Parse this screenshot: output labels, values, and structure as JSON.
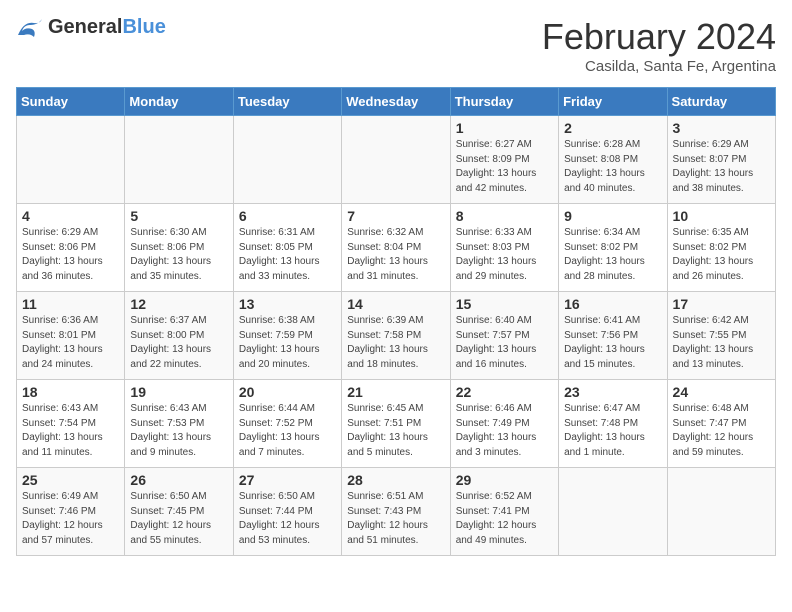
{
  "logo": {
    "general": "General",
    "blue": "Blue"
  },
  "title": "February 2024",
  "subtitle": "Casilda, Santa Fe, Argentina",
  "weekdays": [
    "Sunday",
    "Monday",
    "Tuesday",
    "Wednesday",
    "Thursday",
    "Friday",
    "Saturday"
  ],
  "weeks": [
    [
      {
        "day": "",
        "info": ""
      },
      {
        "day": "",
        "info": ""
      },
      {
        "day": "",
        "info": ""
      },
      {
        "day": "",
        "info": ""
      },
      {
        "day": "1",
        "info": "Sunrise: 6:27 AM\nSunset: 8:09 PM\nDaylight: 13 hours and 42 minutes."
      },
      {
        "day": "2",
        "info": "Sunrise: 6:28 AM\nSunset: 8:08 PM\nDaylight: 13 hours and 40 minutes."
      },
      {
        "day": "3",
        "info": "Sunrise: 6:29 AM\nSunset: 8:07 PM\nDaylight: 13 hours and 38 minutes."
      }
    ],
    [
      {
        "day": "4",
        "info": "Sunrise: 6:29 AM\nSunset: 8:06 PM\nDaylight: 13 hours and 36 minutes."
      },
      {
        "day": "5",
        "info": "Sunrise: 6:30 AM\nSunset: 8:06 PM\nDaylight: 13 hours and 35 minutes."
      },
      {
        "day": "6",
        "info": "Sunrise: 6:31 AM\nSunset: 8:05 PM\nDaylight: 13 hours and 33 minutes."
      },
      {
        "day": "7",
        "info": "Sunrise: 6:32 AM\nSunset: 8:04 PM\nDaylight: 13 hours and 31 minutes."
      },
      {
        "day": "8",
        "info": "Sunrise: 6:33 AM\nSunset: 8:03 PM\nDaylight: 13 hours and 29 minutes."
      },
      {
        "day": "9",
        "info": "Sunrise: 6:34 AM\nSunset: 8:02 PM\nDaylight: 13 hours and 28 minutes."
      },
      {
        "day": "10",
        "info": "Sunrise: 6:35 AM\nSunset: 8:02 PM\nDaylight: 13 hours and 26 minutes."
      }
    ],
    [
      {
        "day": "11",
        "info": "Sunrise: 6:36 AM\nSunset: 8:01 PM\nDaylight: 13 hours and 24 minutes."
      },
      {
        "day": "12",
        "info": "Sunrise: 6:37 AM\nSunset: 8:00 PM\nDaylight: 13 hours and 22 minutes."
      },
      {
        "day": "13",
        "info": "Sunrise: 6:38 AM\nSunset: 7:59 PM\nDaylight: 13 hours and 20 minutes."
      },
      {
        "day": "14",
        "info": "Sunrise: 6:39 AM\nSunset: 7:58 PM\nDaylight: 13 hours and 18 minutes."
      },
      {
        "day": "15",
        "info": "Sunrise: 6:40 AM\nSunset: 7:57 PM\nDaylight: 13 hours and 16 minutes."
      },
      {
        "day": "16",
        "info": "Sunrise: 6:41 AM\nSunset: 7:56 PM\nDaylight: 13 hours and 15 minutes."
      },
      {
        "day": "17",
        "info": "Sunrise: 6:42 AM\nSunset: 7:55 PM\nDaylight: 13 hours and 13 minutes."
      }
    ],
    [
      {
        "day": "18",
        "info": "Sunrise: 6:43 AM\nSunset: 7:54 PM\nDaylight: 13 hours and 11 minutes."
      },
      {
        "day": "19",
        "info": "Sunrise: 6:43 AM\nSunset: 7:53 PM\nDaylight: 13 hours and 9 minutes."
      },
      {
        "day": "20",
        "info": "Sunrise: 6:44 AM\nSunset: 7:52 PM\nDaylight: 13 hours and 7 minutes."
      },
      {
        "day": "21",
        "info": "Sunrise: 6:45 AM\nSunset: 7:51 PM\nDaylight: 13 hours and 5 minutes."
      },
      {
        "day": "22",
        "info": "Sunrise: 6:46 AM\nSunset: 7:49 PM\nDaylight: 13 hours and 3 minutes."
      },
      {
        "day": "23",
        "info": "Sunrise: 6:47 AM\nSunset: 7:48 PM\nDaylight: 13 hours and 1 minute."
      },
      {
        "day": "24",
        "info": "Sunrise: 6:48 AM\nSunset: 7:47 PM\nDaylight: 12 hours and 59 minutes."
      }
    ],
    [
      {
        "day": "25",
        "info": "Sunrise: 6:49 AM\nSunset: 7:46 PM\nDaylight: 12 hours and 57 minutes."
      },
      {
        "day": "26",
        "info": "Sunrise: 6:50 AM\nSunset: 7:45 PM\nDaylight: 12 hours and 55 minutes."
      },
      {
        "day": "27",
        "info": "Sunrise: 6:50 AM\nSunset: 7:44 PM\nDaylight: 12 hours and 53 minutes."
      },
      {
        "day": "28",
        "info": "Sunrise: 6:51 AM\nSunset: 7:43 PM\nDaylight: 12 hours and 51 minutes."
      },
      {
        "day": "29",
        "info": "Sunrise: 6:52 AM\nSunset: 7:41 PM\nDaylight: 12 hours and 49 minutes."
      },
      {
        "day": "",
        "info": ""
      },
      {
        "day": "",
        "info": ""
      }
    ]
  ]
}
